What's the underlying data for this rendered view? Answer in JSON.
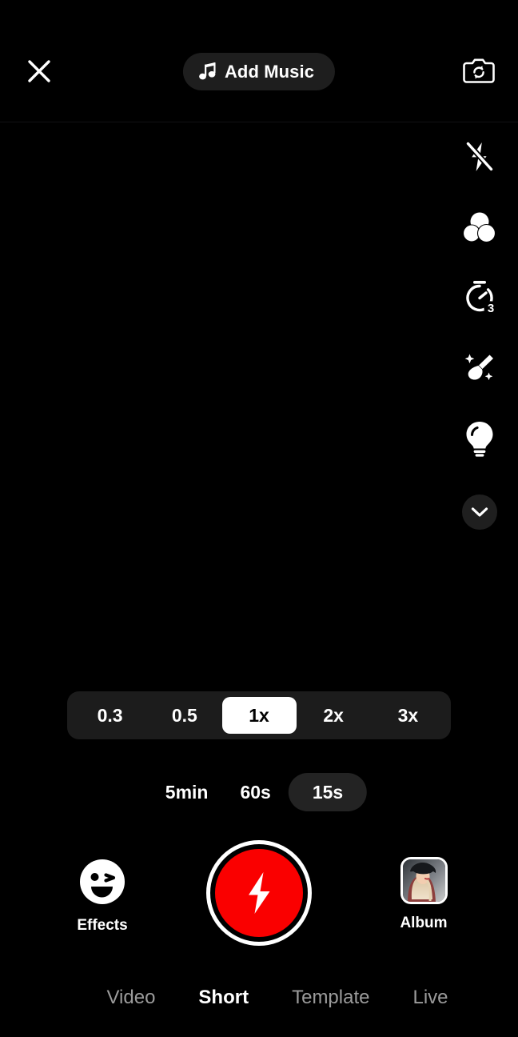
{
  "app": {
    "screen_name": "Camera Capture",
    "background_color": "#000000",
    "accent_color": "#fa0000"
  },
  "topbar": {
    "close_icon": "close-x-icon",
    "music_button": {
      "label": "Add Music",
      "icon": "music-note-icon",
      "background_color": "#1e1e1e"
    },
    "flip_camera_icon": "camera-flip-icon"
  },
  "tool_rail": {
    "items": [
      {
        "name": "flash",
        "icon": "flash-off-icon",
        "label": ""
      },
      {
        "name": "filters",
        "icon": "filters-circles-icon",
        "label": ""
      },
      {
        "name": "timer",
        "icon": "timer-stopwatch-icon",
        "label": "",
        "badge": "3"
      },
      {
        "name": "beautify",
        "icon": "makeup-brush-sparkle-icon",
        "label": ""
      },
      {
        "name": "light",
        "icon": "light-bulb-icon",
        "label": ""
      },
      {
        "name": "more",
        "icon": "chevron-down-icon",
        "label": ""
      }
    ]
  },
  "controls": {
    "speed": {
      "options": [
        "0.3",
        "0.5",
        "1x",
        "2x",
        "3x"
      ],
      "selected": "1x",
      "track_color": "#1c1c1c",
      "selected_color": "#ffffff"
    },
    "duration": {
      "options": [
        "5min",
        "60s",
        "15s"
      ],
      "selected": "15s",
      "selected_color": "#232323"
    },
    "effects": {
      "label": "Effects",
      "icon": "winking-face-icon"
    },
    "record": {
      "icon": "lightning-bolt-icon",
      "color": "#fa0000"
    },
    "album": {
      "label": "Album",
      "icon": "album-thumbnail"
    }
  },
  "modes": {
    "items": [
      "Video",
      "Short",
      "Template",
      "Live"
    ],
    "selected": "Short"
  }
}
